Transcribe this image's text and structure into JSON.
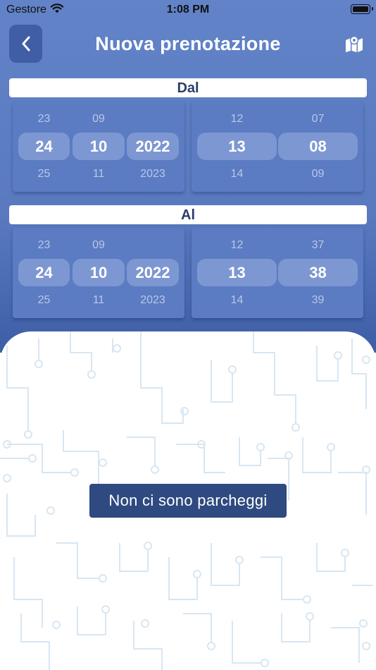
{
  "status_bar": {
    "carrier": "Gestore",
    "time": "1:08 PM"
  },
  "header": {
    "title": "Nuova prenotazione",
    "back_icon": "chevron-left-icon",
    "map_icon": "map-marker-icon"
  },
  "from": {
    "label": "Dal",
    "date": {
      "day": {
        "prev": "23",
        "selected": "24",
        "next": "25"
      },
      "month": {
        "prev": "09",
        "selected": "10",
        "next": "11"
      },
      "year": {
        "prev": "",
        "selected": "2022",
        "next": "2023"
      }
    },
    "time": {
      "hour": {
        "prev": "12",
        "selected": "13",
        "next": "14"
      },
      "minute": {
        "prev": "07",
        "selected": "08",
        "next": "09"
      }
    }
  },
  "to": {
    "label": "Al",
    "date": {
      "day": {
        "prev": "23",
        "selected": "24",
        "next": "25"
      },
      "month": {
        "prev": "09",
        "selected": "10",
        "next": "11"
      },
      "year": {
        "prev": "",
        "selected": "2022",
        "next": "2023"
      }
    },
    "time": {
      "hour": {
        "prev": "12",
        "selected": "13",
        "next": "14"
      },
      "minute": {
        "prev": "37",
        "selected": "38",
        "next": "39"
      }
    }
  },
  "results": {
    "empty_message": "Non ci sono parcheggi"
  },
  "colors": {
    "header_bg": "#6283c8",
    "accent": "#3f5ea5",
    "badge": "#2f4a80",
    "text_dark": "#2a3e6b"
  }
}
